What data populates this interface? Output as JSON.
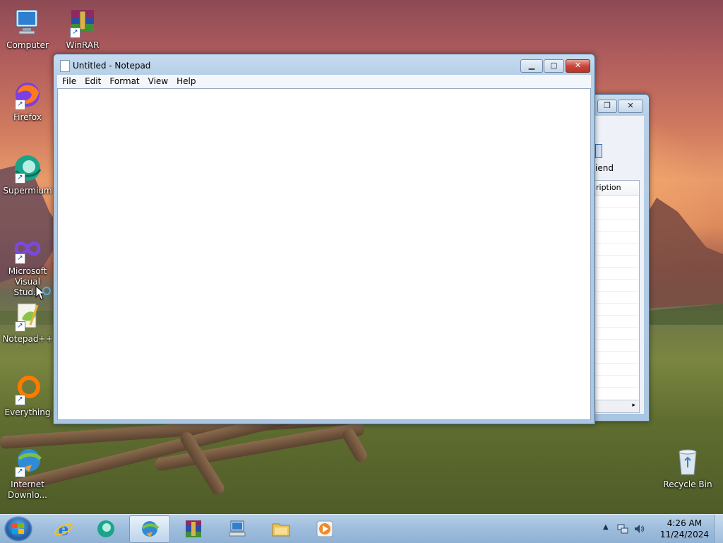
{
  "desktop": {
    "icons": [
      {
        "label": "Computer",
        "icon": "computer-icon"
      },
      {
        "label": "WinRAR",
        "icon": "winrar-icon"
      },
      {
        "label": "Firefox",
        "icon": "firefox-icon"
      },
      {
        "label": "Supermium",
        "icon": "supermium-icon"
      },
      {
        "label": "Microsoft Visual Stud...",
        "icon": "visual-studio-icon"
      },
      {
        "label": "Notepad++",
        "icon": "notepad-plus-plus-icon"
      },
      {
        "label": "Everything",
        "icon": "everything-icon"
      },
      {
        "label": "Internet Downlo...",
        "icon": "internet-download-manager-icon"
      },
      {
        "label": "Recycle Bin",
        "icon": "recycle-bin-icon"
      }
    ]
  },
  "background_window": {
    "partial_label_1": "iend",
    "partial_label_2": "ription"
  },
  "notepad": {
    "title": "Untitled - Notepad",
    "menu": [
      "File",
      "Edit",
      "Format",
      "View",
      "Help"
    ],
    "content": ""
  },
  "taskbar": {
    "items": [
      {
        "icon": "internet-explorer-icon",
        "active": false
      },
      {
        "icon": "supermium-icon",
        "active": false
      },
      {
        "icon": "internet-download-manager-icon",
        "active": true
      },
      {
        "icon": "winrar-icon",
        "active": false
      },
      {
        "icon": "network-computer-icon",
        "active": false
      },
      {
        "icon": "file-explorer-icon",
        "active": false
      },
      {
        "icon": "media-player-icon",
        "active": false
      }
    ],
    "clock": {
      "time": "4:26 AM",
      "date": "11/24/2024"
    }
  },
  "colors": {
    "taskbar": "#9fbedd",
    "window_frame": "#b7d0e8",
    "close_button": "#c7473a"
  }
}
